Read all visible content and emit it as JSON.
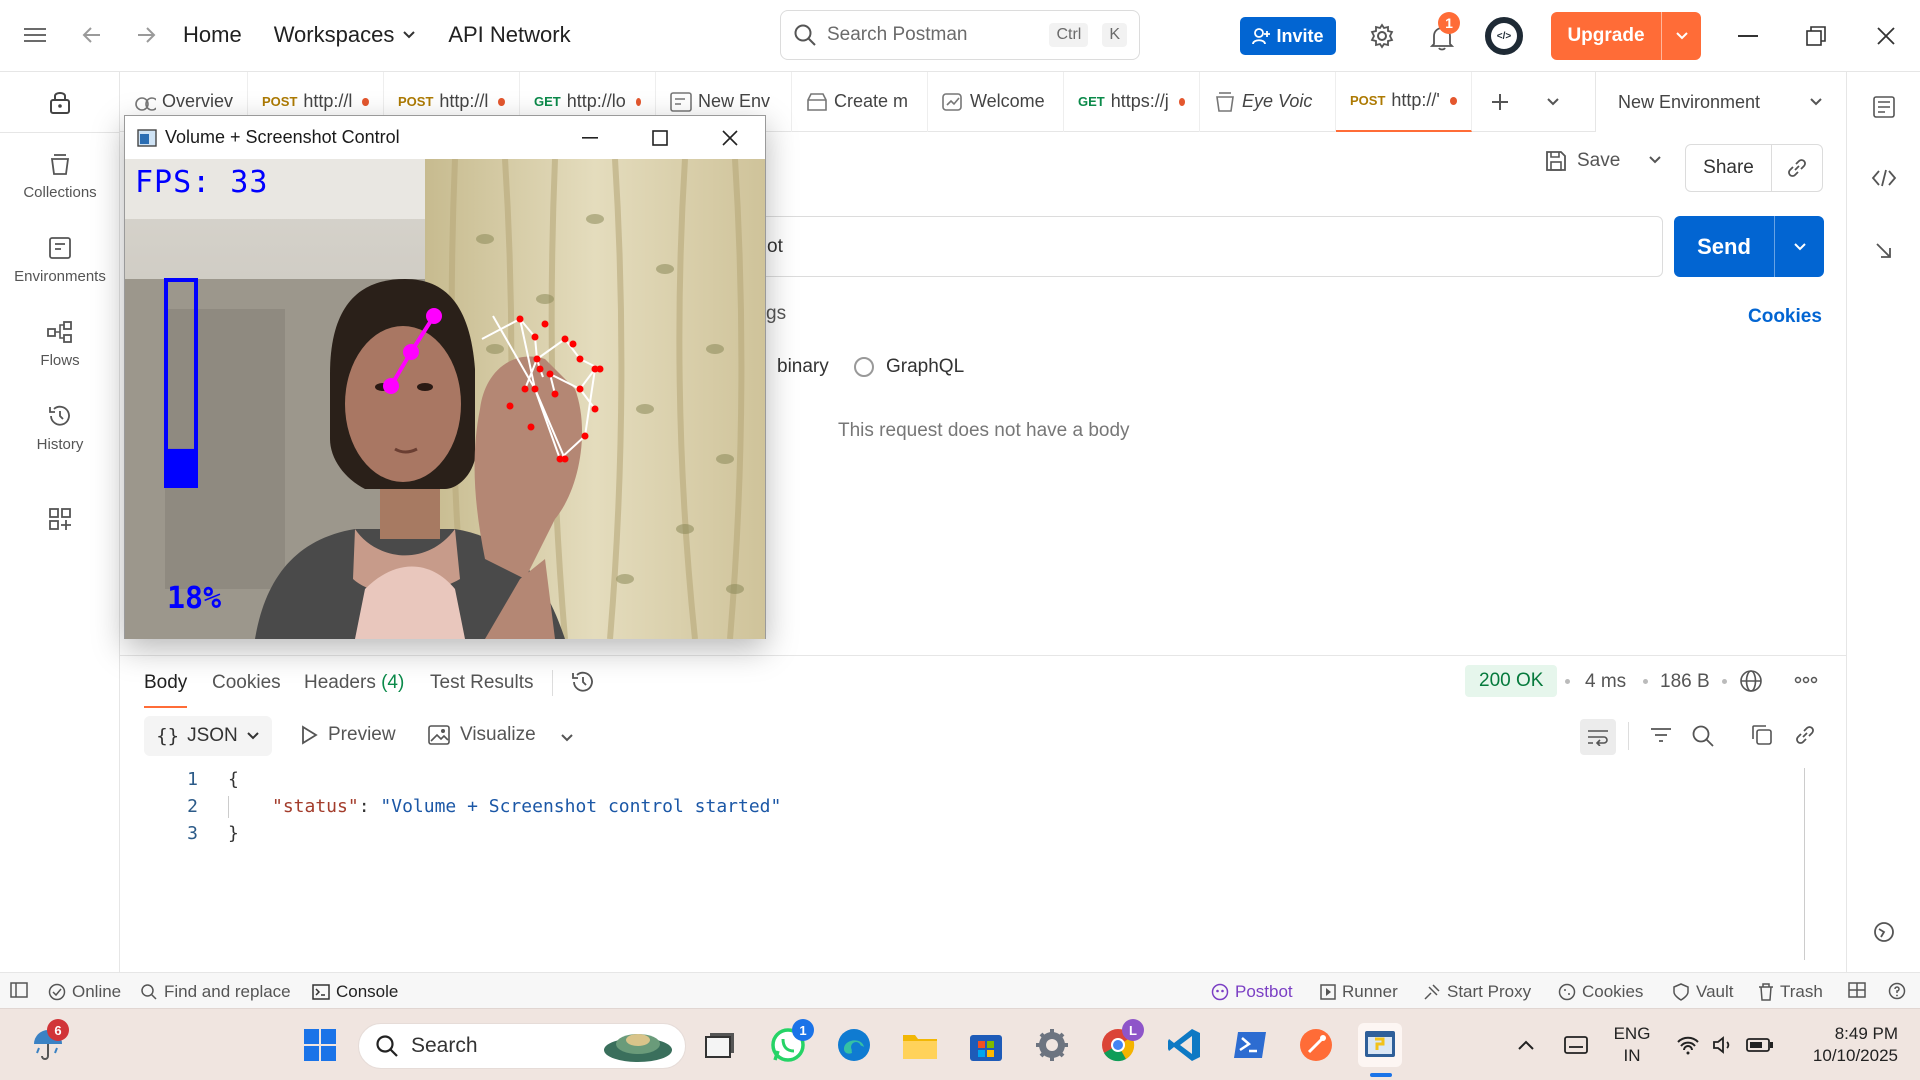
{
  "titlebar": {
    "nav": [
      "Home",
      "Workspaces",
      "API Network"
    ],
    "search_placeholder": "Search Postman",
    "search_kbd1": "Ctrl",
    "search_kbd2": "K",
    "invite_label": "Invite",
    "notifications_count": "1",
    "upgrade_label": "Upgrade"
  },
  "sidebar": {
    "items": [
      {
        "label": "Collections",
        "icon": "collections-icon"
      },
      {
        "label": "Environments",
        "icon": "environments-icon"
      },
      {
        "label": "Flows",
        "icon": "flows-icon"
      },
      {
        "label": "History",
        "icon": "history-icon"
      }
    ]
  },
  "tabs": [
    {
      "method": "",
      "label": "Overviev",
      "dot": false
    },
    {
      "method": "POST",
      "label": "http://l",
      "dot": true
    },
    {
      "method": "POST",
      "label": "http://l",
      "dot": true
    },
    {
      "method": "GET",
      "label": "http://lo",
      "dot": true
    },
    {
      "method": "",
      "label": "New Env",
      "dot": false
    },
    {
      "method": "",
      "label": "Create m",
      "dot": false
    },
    {
      "method": "",
      "label": "Welcome",
      "dot": false
    },
    {
      "method": "GET",
      "label": "https://j",
      "dot": true
    },
    {
      "method": "",
      "label": "Eye Voic",
      "dot": false
    },
    {
      "method": "POST",
      "label": "http://'",
      "dot": true
    }
  ],
  "environment": {
    "selected": "New Environment"
  },
  "request": {
    "save_label": "Save",
    "share_label": "Share",
    "url_fragment": "ot",
    "send_label": "Send",
    "settings_fragment": "gs",
    "cookies_label": "Cookies",
    "body_options": [
      "binary",
      "GraphQL"
    ],
    "no_body_text": "This request does not have a body"
  },
  "response": {
    "tabs": [
      "Body",
      "Cookies",
      "Headers",
      "Test Results"
    ],
    "headers_count": "(4)",
    "status": "200 OK",
    "time": "4 ms",
    "size": "186 B",
    "format": "JSON",
    "preview_label": "Preview",
    "visualize_label": "Visualize",
    "code": {
      "line_numbers": [
        "1",
        "2",
        "3"
      ],
      "open_brace": "{",
      "key": "\"status\"",
      "colon": ": ",
      "value": "\"Volume + Screenshot control started\"",
      "close_brace": "}"
    }
  },
  "statusbar": {
    "left": [
      "Online",
      "Find and replace",
      "Console"
    ],
    "right": [
      "Postbot",
      "Runner",
      "Start Proxy",
      "Cookies",
      "Vault",
      "Trash"
    ]
  },
  "camera_window": {
    "title": "Volume + Screenshot Control",
    "fps_text": "FPS: 33",
    "volume_percent_text": "18%",
    "volume_level": 0.18
  },
  "taskbar": {
    "search_label": "Search",
    "weather_badge": "6",
    "whatsapp_badge": "1",
    "chrome_badge": "L",
    "lang_line1": "ENG",
    "lang_line2": "IN",
    "time": "8:49 PM",
    "date": "10/10/2025"
  },
  "colors": {
    "accent": "#ff6c37",
    "primary": "#0265d2",
    "success_bg": "#e6f6ec",
    "success_text": "#067a3d",
    "hand_landmark": "#ff0000",
    "hand_highlight": "#ff00ff",
    "volume_bar": "#0000ff"
  }
}
